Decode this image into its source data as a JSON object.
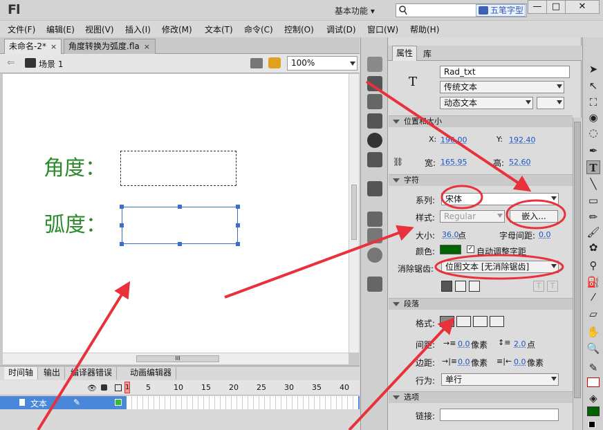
{
  "titlebar": {
    "logo": "Fl",
    "workspace": "基本功能 ▾",
    "ime_text": "五笔字型",
    "win_min": "—",
    "win_max": "□",
    "win_close": "✕"
  },
  "menus": [
    "文件(F)",
    "编辑(E)",
    "视图(V)",
    "插入(I)",
    "修改(M)",
    "文本(T)",
    "命令(C)",
    "控制(O)",
    "调试(D)",
    "窗口(W)",
    "帮助(H)"
  ],
  "doc_tabs": [
    {
      "label": "未命名-2*",
      "close": "×"
    },
    {
      "label": "角度转换为弧度.fla",
      "close": "×"
    }
  ],
  "scene": {
    "label": "场景 1",
    "zoom": "100%"
  },
  "stage": {
    "label_angle": "角度：",
    "label_radian": "弧度："
  },
  "hscroll_grip": "III",
  "timeline": {
    "tabs": [
      "时间轴",
      "输出",
      "编译器错误",
      "动画编辑器"
    ],
    "frame_numbers": [
      "5",
      "10",
      "15",
      "20",
      "25",
      "30",
      "35",
      "40"
    ],
    "current_frame": "1",
    "layer_name": "文本"
  },
  "props": {
    "tabs": [
      "属性",
      "库"
    ],
    "instance_name": "Rad_txt",
    "text_engine": "传统文本",
    "text_type": "动态文本",
    "sec_pos": "位置和大小",
    "x_label": "X:",
    "x_val": "196.00",
    "y_label": "Y:",
    "y_val": "192.40",
    "w_label": "宽:",
    "w_val": "165.95",
    "h_label": "高:",
    "h_val": "52.60",
    "sec_char": "字符",
    "family_label": "系列:",
    "family_val": "宋体",
    "style_label": "样式:",
    "style_val": "Regular",
    "embed_btn": "嵌入...",
    "size_label": "大小:",
    "size_val": "36.0",
    "size_unit": "点",
    "spacing_label": "字母间距:",
    "spacing_val": "0.0",
    "color_label": "颜色:",
    "autokern": "自动调整字距",
    "text_color": "#006400",
    "aa_label": "消除锯齿:",
    "aa_val": "位图文本 [无消除锯齿]",
    "sec_para": "段落",
    "format_label": "格式:",
    "gap_label": "间距:",
    "gap_val1": "0.0",
    "gap_unit1": "像素",
    "gap_val2": "2.0",
    "gap_unit2": "点",
    "margin_label": "边距:",
    "margin_val1": "0.0",
    "margin_unit1": "像素",
    "margin_val2": "0.0",
    "margin_unit2": "像素",
    "behavior_label": "行为:",
    "behavior_val": "单行",
    "sec_opt": "选项",
    "link_label": "链接:"
  },
  "colors": {
    "accent_red": "#e8313a",
    "stage_text": "#2b8b2b",
    "selection": "#3a6fd0"
  }
}
